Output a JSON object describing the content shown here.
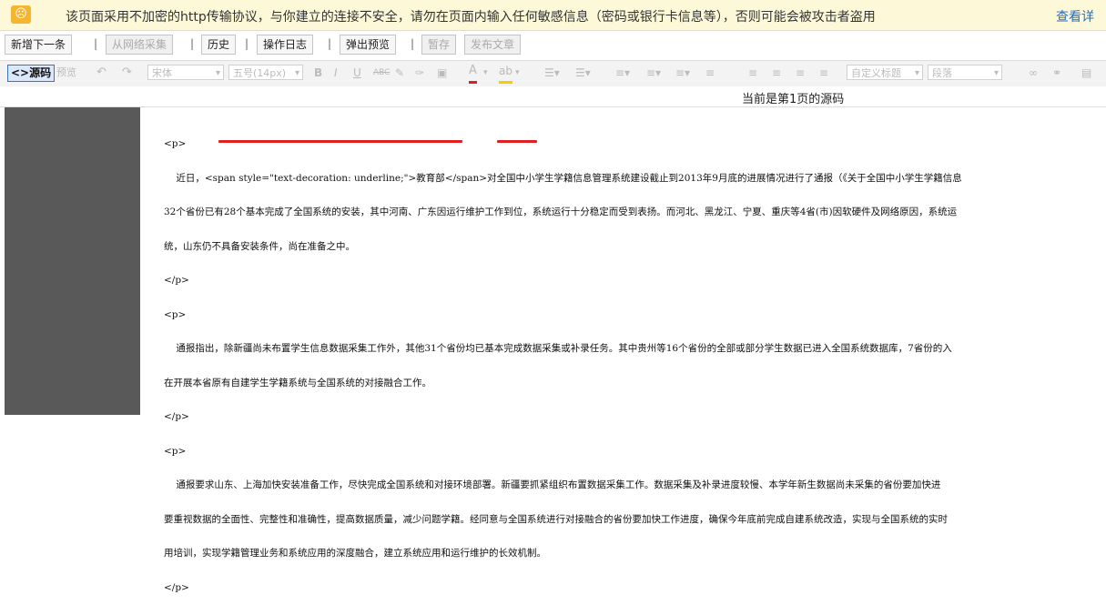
{
  "warning": {
    "icon": "warning-icon",
    "text": "该页面采用不加密的http传输协议，与你建立的连接不安全，请勿在页面内输入任何敏感信息（密码或银行卡信息等），否则可能会被攻击者盗用",
    "link": "查看详"
  },
  "buttons": {
    "new_next": "新增下一条",
    "fetch": "从网络采集",
    "history": "历史",
    "log": "操作日志",
    "preview": "弹出预览",
    "pause": "暂存",
    "publish": "发布文章",
    "separator": "|"
  },
  "toolbar": {
    "source": "<>源码",
    "preview": "预览",
    "font": "宋体",
    "size": "五号(14px)",
    "bold": "B",
    "italic": "I",
    "underline": "U",
    "strike": "ABC",
    "font_color": "A",
    "title_style": "自定义标题",
    "paragraph": "段落"
  },
  "page_info": "当前是第1页的源码",
  "source_lines": {
    "l1": "<p>",
    "l2a": "    近日，",
    "l2b": "<span style=\"text-decoration: underline;\">",
    "l2c": "教育部",
    "l2d": "</span>",
    "l2e": "对全国中小学生学籍信息管理系统建设截止到2013年9月底的进展情况进行了通报（《关于全国中小学生学籍信息",
    "l3": "32个省份已有28个基本完成了全国系统的安装，其中河南、广东因运行维护工作到位，系统运行十分稳定而受到表扬。而河北、黑龙江、宁夏、重庆等4省(市)因软硬件及网络原因，系统运",
    "l4": "统，山东仍不具备安装条件，尚在准备之中。",
    "l5": "</p>",
    "l6": "<p>",
    "l7": "    通报指出，除新疆尚未布置学生信息数据采集工作外，其他31个省份均已基本完成数据采集或补录任务。其中贵州等16个省份的全部或部分学生数据已进入全国系统数据库，7省份的入",
    "l8": "在开展本省原有自建学生学籍系统与全国系统的对接融合工作。",
    "l9": "</p>",
    "l10": "<p>",
    "l11": "    通报要求山东、上海加快安装准备工作，尽快完成全国系统和对接环境部署。新疆要抓紧组织布置数据采集工作。数据采集及补录进度较慢、本学年新生数据尚未采集的省份要加快进",
    "l12": "要重视数据的全面性、完整性和准确性，提高数据质量，减少问题学籍。经同意与全国系统进行对接融合的省份要加快工作进度，确保今年底前完成自建系统改造，实现与全国系统的实时",
    "l13": "用培训，实现学籍管理业务和系统应用的深度融合，建立系统应用和运行维护的长效机制。",
    "l14": "</p>"
  }
}
